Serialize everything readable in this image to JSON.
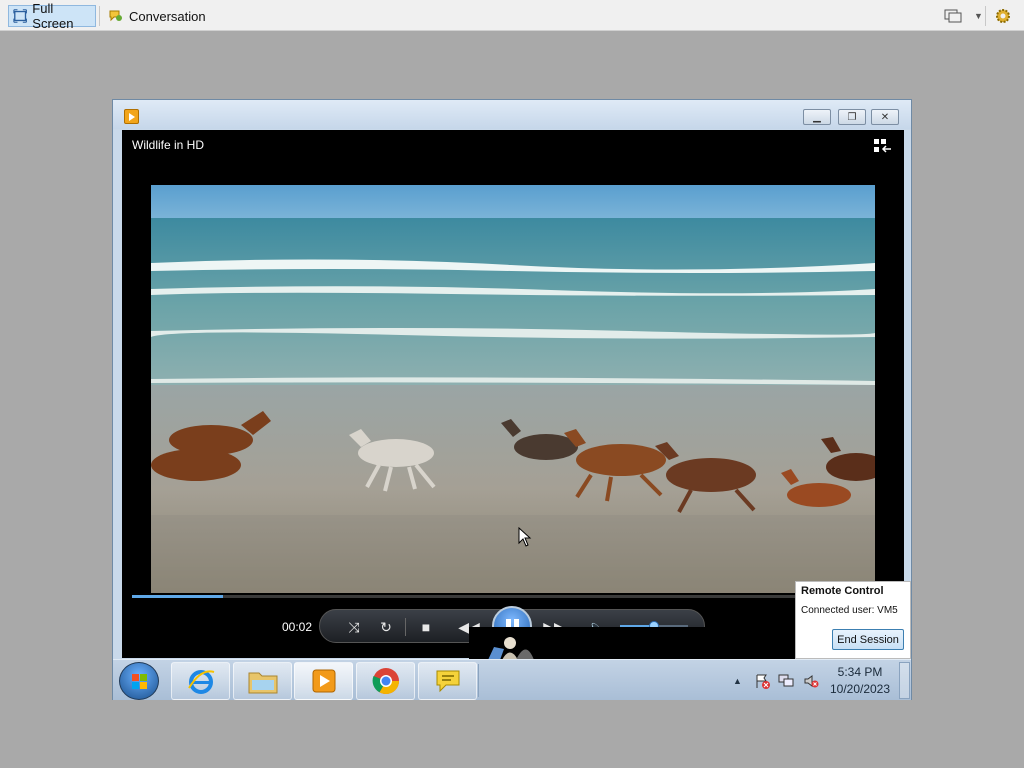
{
  "host_toolbar": {
    "full_screen_label": "Full Screen",
    "conversation_label": "Conversation"
  },
  "player": {
    "title": "Wildlife in HD",
    "elapsed": "00:02",
    "seek_progress": 0.13,
    "volume_level": 0.5
  },
  "taskbar": {
    "pinned": [
      "internet-explorer-icon",
      "windows-explorer-icon",
      "windows-media-player-icon",
      "chrome-icon",
      "messenger-icon"
    ],
    "clock_time": "5:34 PM",
    "clock_date": "10/20/2023"
  },
  "remote_control": {
    "title": "Remote Control",
    "connected_user": "Connected user: VM5",
    "end_session_label": "End Session"
  },
  "colors": {
    "page_bg": "#a9a9a9",
    "accent": "#5fa8e8",
    "taskbar": "#b6c8dc"
  }
}
